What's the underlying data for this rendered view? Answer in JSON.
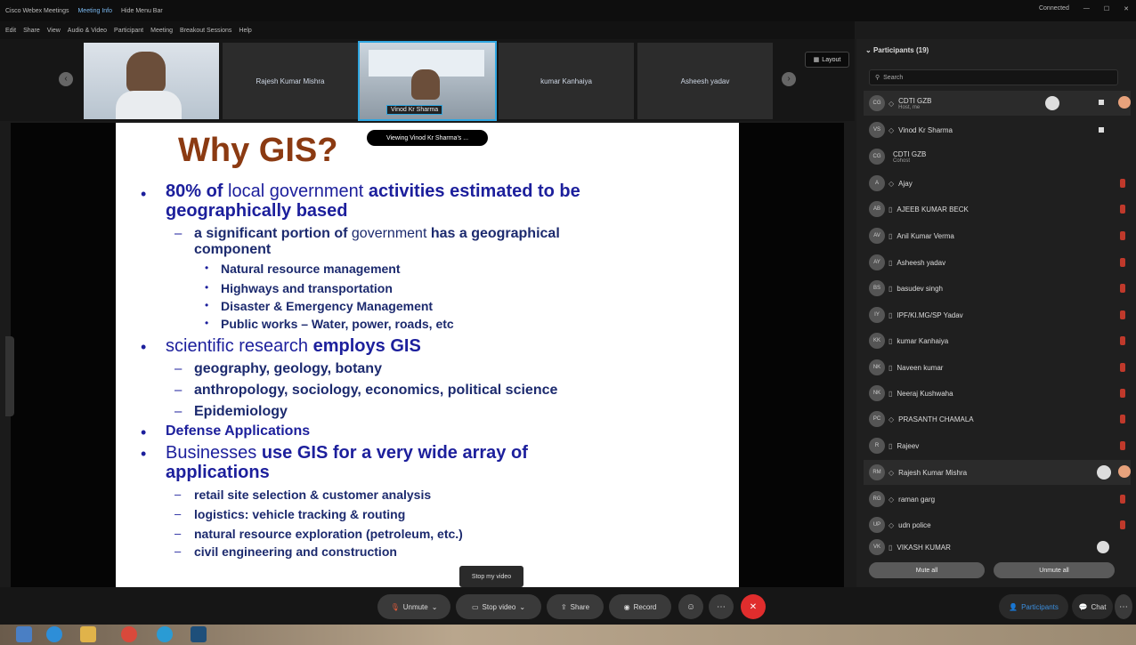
{
  "titlebar": {
    "app": "Cisco Webex Meetings",
    "info": "Meeting Info",
    "hide": "Hide Menu Bar",
    "status": "Connected"
  },
  "menu": [
    "Edit",
    "Share",
    "View",
    "Audio & Video",
    "Participant",
    "Meeting",
    "Breakout Sessions",
    "Help"
  ],
  "strip": {
    "tiles": [
      "Rajesh Kumar Mishra",
      "kumar Kanhaiya",
      "Asheesh yadav"
    ],
    "active_name": "Vinod Kr Sharma",
    "layout_label": "Layout"
  },
  "viewing_label": "Viewing Vinod Kr Sharma's ...",
  "slide": {
    "title": "Why GIS?",
    "b1_a": "80% of ",
    "b1_b": "local government ",
    "b1_c": "activities estimated to be",
    "b1_d": "geographically based",
    "s1_a": "a significant portion of ",
    "s1_b": "government ",
    "s1_c": "has a geographical",
    "s1_d": "component",
    "t1": "Natural resource management",
    "t2": "Highways and transportation",
    "t3": "Disaster & Emergency Management",
    "t4": "Public works – Water, power, roads, etc",
    "b2_a": "scientific research ",
    "b2_b": "employs GIS",
    "s2": "geography, geology, botany",
    "s3": "anthropology, sociology, economics, political science",
    "s4": "Epidemiology",
    "b3": "Defense Applications",
    "b4_a": "Businesses ",
    "b4_b": "use GIS for a very wide array of",
    "b4_c": "applications",
    "u1": "retail site selection & customer analysis",
    "u2": "logistics: vehicle tracking & routing",
    "u3": "natural resource exploration (petroleum, etc.)",
    "u4": "civil engineering and construction"
  },
  "panel": {
    "title": "Participants (19)",
    "search_placeholder": "Search",
    "participants": [
      {
        "initials": "CG",
        "name": "CDTI GZB",
        "sub": "Host, me"
      },
      {
        "initials": "VS",
        "name": "Vinod Kr Sharma",
        "sub": ""
      },
      {
        "initials": "CG",
        "name": "CDTI GZB",
        "sub": "Cohost"
      },
      {
        "initials": "A",
        "name": "Ajay",
        "sub": ""
      },
      {
        "initials": "AB",
        "name": "AJEEB KUMAR BECK",
        "sub": ""
      },
      {
        "initials": "AV",
        "name": "Anil Kumar Verma",
        "sub": ""
      },
      {
        "initials": "AY",
        "name": "Asheesh yadav",
        "sub": ""
      },
      {
        "initials": "BS",
        "name": "basudev singh",
        "sub": ""
      },
      {
        "initials": "IY",
        "name": "IPF/KI.MG/SP Yadav",
        "sub": ""
      },
      {
        "initials": "KK",
        "name": "kumar Kanhaiya",
        "sub": ""
      },
      {
        "initials": "NK",
        "name": "Naveen kumar",
        "sub": ""
      },
      {
        "initials": "NK",
        "name": "Neeraj Kushwaha",
        "sub": ""
      },
      {
        "initials": "PC",
        "name": "PRASANTH CHAMALA",
        "sub": ""
      },
      {
        "initials": "R",
        "name": "Rajeev",
        "sub": ""
      },
      {
        "initials": "RM",
        "name": "Rajesh Kumar Mishra",
        "sub": ""
      },
      {
        "initials": "RG",
        "name": "raman garg",
        "sub": ""
      },
      {
        "initials": "UP",
        "name": "udn police",
        "sub": ""
      },
      {
        "initials": "VK",
        "name": "VIKASH KUMAR",
        "sub": ""
      }
    ],
    "mute_all": "Mute all",
    "unmute_all": "Unmute all"
  },
  "controls": {
    "unmute": "Unmute",
    "stop_video": "Stop video",
    "share": "Share",
    "record": "Record",
    "tooltip": "Stop my video",
    "participants": "Participants",
    "chat": "Chat"
  }
}
